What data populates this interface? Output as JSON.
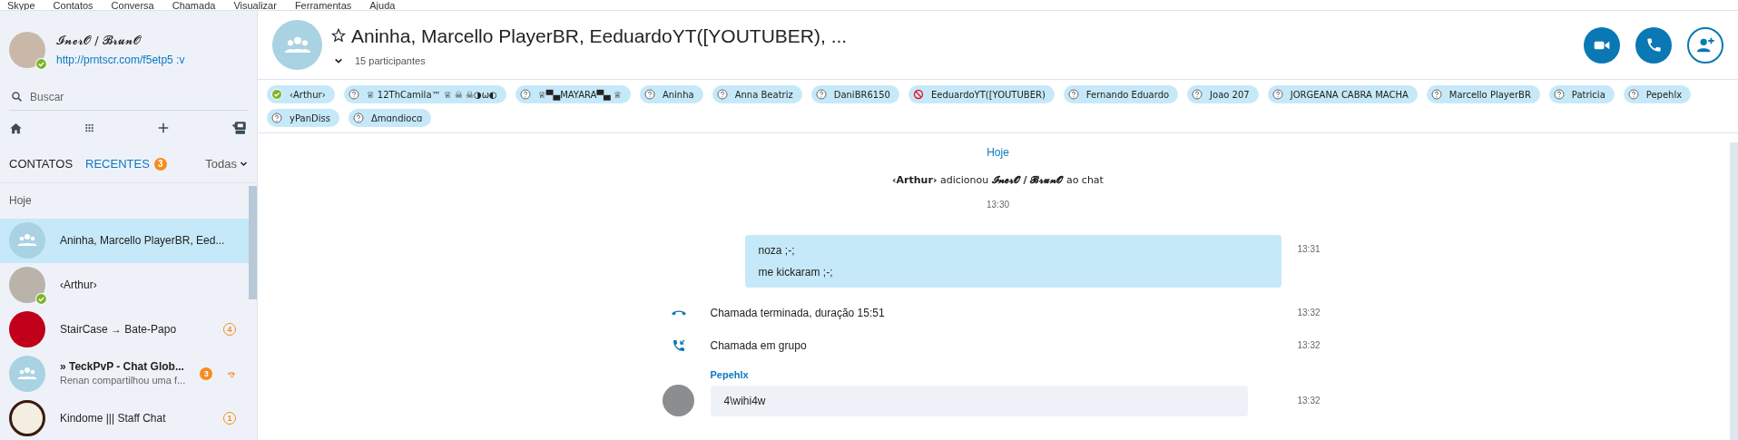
{
  "menu": [
    "Skype",
    "Contatos",
    "Conversa",
    "Chamada",
    "Visualizar",
    "Ferramentas",
    "Ajuda"
  ],
  "profile": {
    "name": "𝓘𝓷𝓮𝓻𝓞 / 𝓑𝓻𝓾𝓷𝓞",
    "mood": "http://prntscr.com/f5etp5 :v",
    "online": true
  },
  "search": {
    "placeholder": "Buscar"
  },
  "list_tabs": [
    {
      "label": "CONTATOS",
      "selected": false
    },
    {
      "label": "RECENTES",
      "selected": true,
      "badge": "3"
    }
  ],
  "filter": "Todas",
  "section": "Hoje",
  "recents": [
    {
      "name": "Aninha, Marcello PlayerBR, Eed...",
      "kind": "group",
      "selected": true,
      "bold": false
    },
    {
      "name": "‹Arthur›",
      "kind": "photo",
      "online": true,
      "selected": false,
      "bold": false
    },
    {
      "name": "StairCase → Bate-Papo",
      "kind": "logo-red",
      "selected": false,
      "bold": false,
      "badge": {
        "text": "4",
        "kind": "outline"
      }
    },
    {
      "name": "» TeckPvP - Chat Glob...",
      "preview": "Renan compartilhou uma f...",
      "kind": "group",
      "selected": false,
      "bold": true,
      "badge": {
        "text": "3",
        "kind": "filled"
      },
      "call": true
    },
    {
      "name": "Kindome ||| Staff Chat",
      "kind": "logo-k",
      "selected": false,
      "bold": false,
      "badge": {
        "text": "1",
        "kind": "outline"
      }
    }
  ],
  "conversation": {
    "title": "Aninha, Marcello PlayerBR, EeduardoYT([YOUTUBER), ...",
    "participants": "15 participantes",
    "favorite": false
  },
  "participants": [
    {
      "name": "‹Arthur›",
      "kind": "online"
    },
    {
      "name": "♕ 12ThCamila™ ♕ ☠ ☠◑ω◐",
      "kind": "unknown"
    },
    {
      "name": "♕▀▄MAYARA▀▄ ♕",
      "kind": "unknown"
    },
    {
      "name": "Aninha",
      "kind": "unknown"
    },
    {
      "name": "Anna Beatriz",
      "kind": "unknown"
    },
    {
      "name": "DaniBR6150",
      "kind": "unknown"
    },
    {
      "name": "EeduardoYT([YOUTUBER)",
      "kind": "blocked"
    },
    {
      "name": "Fernando Eduardo",
      "kind": "unknown"
    },
    {
      "name": "Joao 207",
      "kind": "unknown"
    },
    {
      "name": "JORGEANA CABRA MACHA",
      "kind": "unknown"
    },
    {
      "name": "Marcello PlayerBR",
      "kind": "unknown"
    },
    {
      "name": "Patricia",
      "kind": "unknown"
    },
    {
      "name": "Pepehlx",
      "kind": "unknown"
    },
    {
      "name": "yPanDiss",
      "kind": "unknown"
    },
    {
      "name": "Δmɑndiocɑ",
      "kind": "unknown"
    }
  ],
  "messages": [
    {
      "kind": "date",
      "text": "Hoje"
    },
    {
      "kind": "system",
      "text": "**‹Arthur›** adicionou **𝓘𝓷𝓮𝓻𝓞 / 𝓑𝓻𝓾𝓷𝓞** ao chat",
      "time": "13:30"
    },
    {
      "kind": "outgoing",
      "lines": [
        "noza ;-;",
        "me kickaram ;-;"
      ],
      "time": "13:31"
    },
    {
      "kind": "call-ended",
      "text": "Chamada terminada, duração 15:51",
      "time": "13:32"
    },
    {
      "kind": "group-call",
      "text": "Chamada em grupo",
      "time": "13:32"
    },
    {
      "kind": "incoming",
      "sender": "Pepehlx",
      "lines": [
        "4\\wihi4w"
      ],
      "time": "13:32"
    }
  ]
}
